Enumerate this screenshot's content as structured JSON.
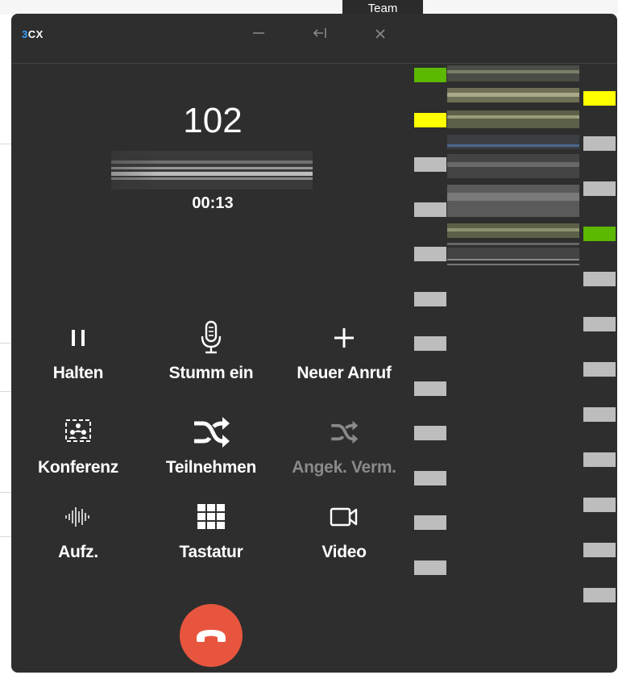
{
  "window": {
    "logo": "3CX",
    "background_tab": "Team"
  },
  "titlebar": {
    "minimize_icon": "minimize-icon",
    "pin_icon": "collapse-left-icon",
    "close_icon": "close-icon"
  },
  "call": {
    "extension": "102",
    "duration": "00:13"
  },
  "actions": [
    {
      "label": "Halten",
      "icon": "pause-icon",
      "enabled": true
    },
    {
      "label": "Stumm ein",
      "icon": "microphone-icon",
      "enabled": true
    },
    {
      "label": "Neuer Anruf",
      "icon": "plus-icon",
      "enabled": true
    },
    {
      "label": "Konferenz",
      "icon": "conference-icon",
      "enabled": true
    },
    {
      "label": "Teilnehmen",
      "icon": "shuffle-icon",
      "enabled": true
    },
    {
      "label": "Angek. Verm.",
      "icon": "shuffle-icon",
      "enabled": false
    },
    {
      "label": "Aufz.",
      "icon": "waveform-icon",
      "enabled": true
    },
    {
      "label": "Tastatur",
      "icon": "keypad-icon",
      "enabled": true
    },
    {
      "label": "Video",
      "icon": "video-camera-icon",
      "enabled": true
    }
  ],
  "hangup": {
    "icon": "hang-up-icon"
  },
  "colors": {
    "window_bg": "#2e2e2e",
    "hangup": "#e8553e",
    "logo_accent": "#3aa0ff",
    "status_green": "#5cb800",
    "status_yellow": "#ffff00",
    "status_idle": "#bdbdbd",
    "disabled_text": "#8a8a8a"
  },
  "status_indicators": {
    "left_column": [
      "green",
      "yellow",
      "idle",
      "idle",
      "idle",
      "idle",
      "idle",
      "idle",
      "idle",
      "idle",
      "idle",
      "idle"
    ],
    "right_column": [
      "yellow",
      "idle",
      "idle",
      "green",
      "idle",
      "idle",
      "idle",
      "idle",
      "idle",
      "idle",
      "idle",
      "idle"
    ]
  }
}
